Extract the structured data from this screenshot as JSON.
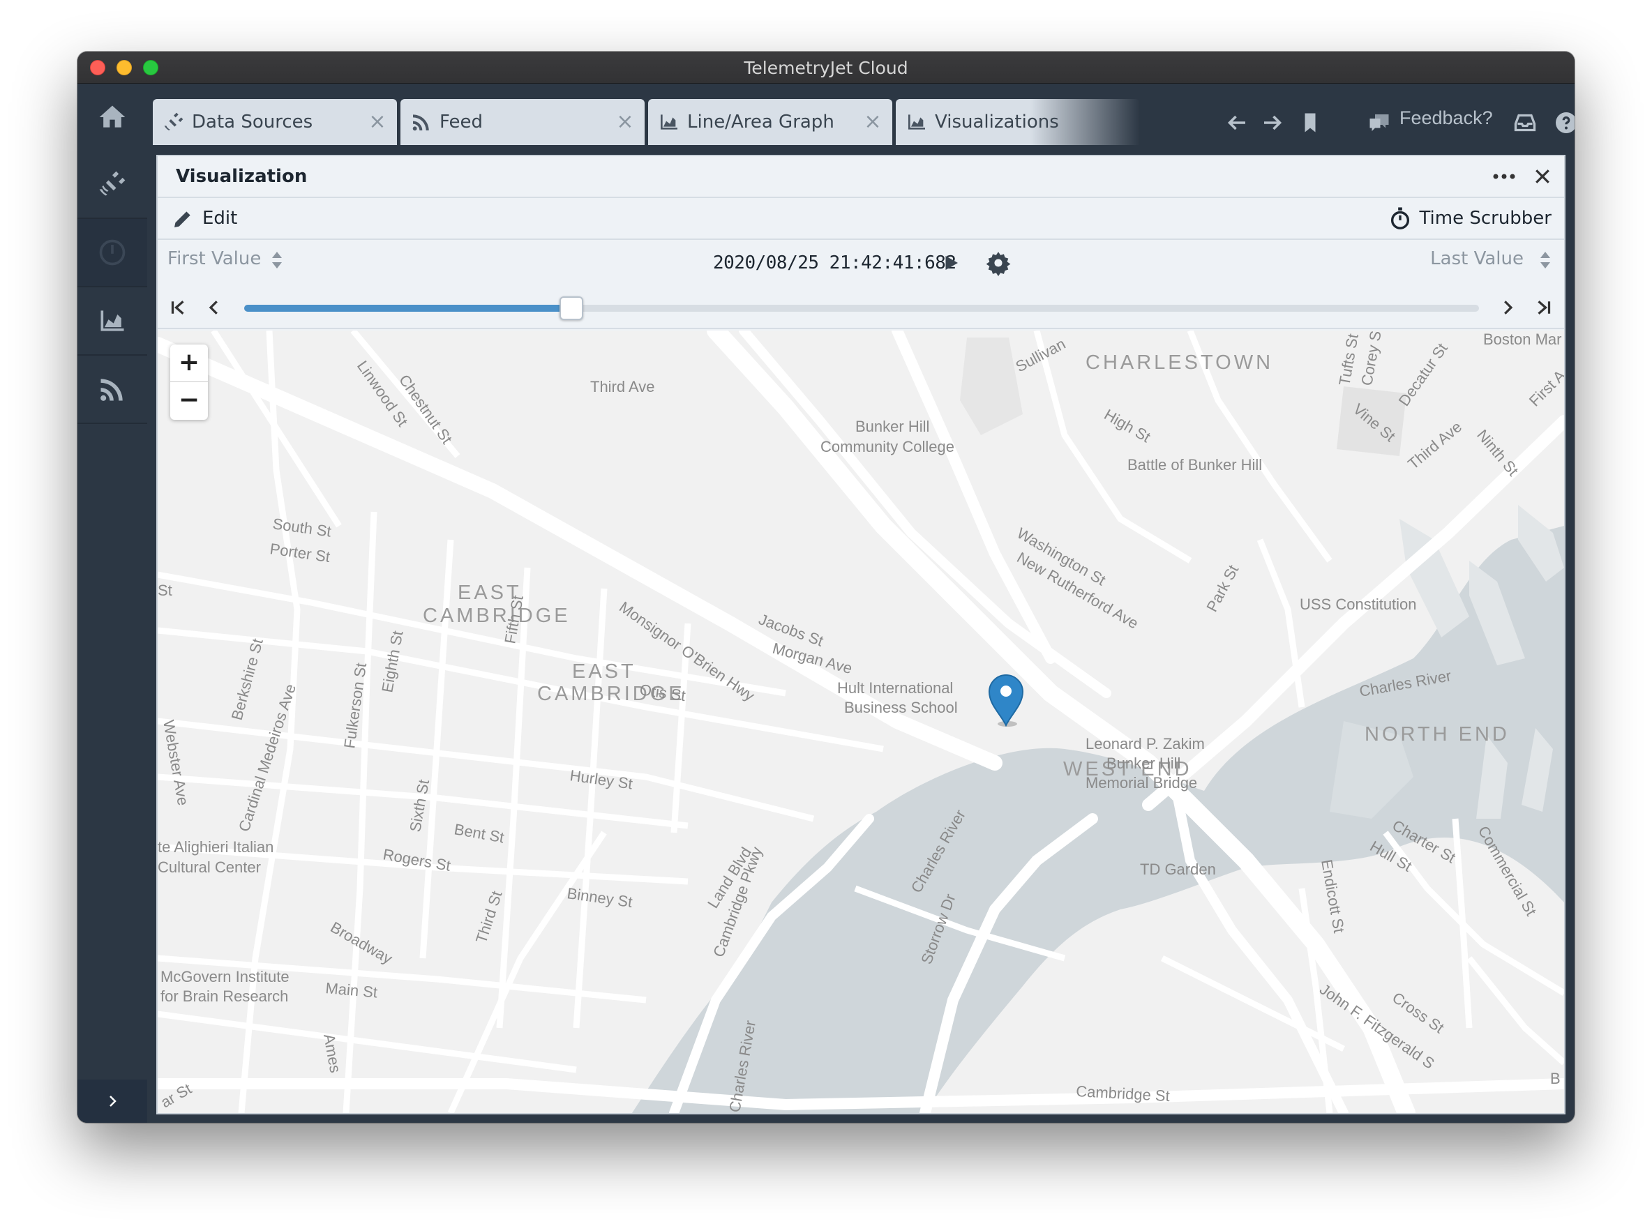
{
  "window": {
    "title": "TelemetryJet Cloud"
  },
  "sidebar": {
    "items": [
      {
        "icon": "home-icon"
      },
      {
        "icon": "satellite-icon"
      },
      {
        "icon": "gauge-icon"
      },
      {
        "icon": "area-chart-icon"
      },
      {
        "icon": "feed-icon"
      }
    ],
    "collapse_icon": "chevron-right-icon"
  },
  "tabs": [
    {
      "label": "Data Sources",
      "icon": "satellite-icon"
    },
    {
      "label": "Feed",
      "icon": "feed-icon"
    },
    {
      "label": "Line/Area Graph",
      "icon": "area-chart-icon"
    },
    {
      "label": "Visualizations",
      "icon": "area-chart-icon"
    }
  ],
  "toolbar": {
    "feedback_label": "Feedback?"
  },
  "panel": {
    "title": "Visualization",
    "edit_label": "Edit",
    "time_scrubber_label": "Time Scrubber",
    "first_value_label": "First Value",
    "last_value_label": "Last Value",
    "timestamp": "2020/08/25 21:42:41:682",
    "scrub_progress": 0.265
  },
  "map": {
    "zoom_in": "+",
    "zoom_out": "−",
    "areas": [
      "CHARLESTOWN",
      "EAST",
      "CAMBRIDGE",
      "EAST",
      "CAMBRIDGE",
      "WEST END",
      "NORTH END"
    ],
    "labels": [
      "Third Ave",
      "Sullivan",
      "Tufts St",
      "Corey St",
      "Decatur St",
      "Boston Mar",
      "First A",
      "Linwood St",
      "Chestnut St",
      "Bunker Hill",
      "Community College",
      "High St",
      "Vine St",
      "Battle of Bunker Hill",
      "Third Ave",
      "Ninth St",
      "South St",
      "Porter St",
      "Washington St",
      "New Rutherford Ave",
      "Park St",
      "USS Constitution",
      "Jacobs St",
      "Fifth St",
      "Morgan Ave",
      "Monsignor O'Brien Hwy",
      "Berkshire St",
      "Cardinal Medeiros Ave",
      "Fulkerson St",
      "Eighth St",
      "Otis St",
      "Hult International",
      "Business School",
      "Charles River",
      "Webster Ave",
      "Leonard P. Zakim",
      "Bunker Hill",
      "Memorial Bridge",
      "Hurley St",
      "Sixth St",
      "Bent St",
      "te Alighieri Italian",
      "Cultural Center",
      "Rogers St",
      "Land Blvd",
      "Cambridge Pkwy",
      "Charles River",
      "Charter St",
      "Hull St",
      "Commercial St",
      "TD Garden",
      "Binney St",
      "Storrow Dr",
      "Endicott St",
      "Broadway",
      "Third St",
      "McGovern Institute",
      "for Brain Research",
      "Main St",
      "Ames",
      "John F. Fitzgerald S",
      "Cross St",
      "Cambridge St",
      "Charles River",
      "ar St",
      "St",
      "B"
    ]
  }
}
